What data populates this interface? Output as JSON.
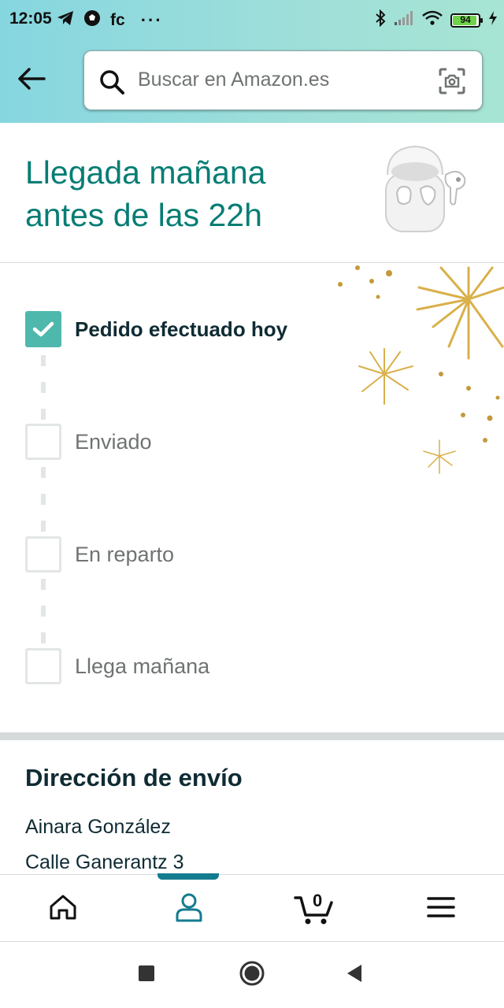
{
  "status_bar": {
    "time": "12:05",
    "carrier_text": "fc",
    "more": "···",
    "battery": "94"
  },
  "search": {
    "placeholder": "Buscar en Amazon.es"
  },
  "arrival": {
    "title_line1": "Llegada mañana",
    "title_line2": "antes de las 22h"
  },
  "progress": {
    "steps": [
      {
        "label": "Pedido efectuado hoy",
        "done": true
      },
      {
        "label": "Enviado",
        "done": false
      },
      {
        "label": "En reparto",
        "done": false
      },
      {
        "label": "Llega mañana",
        "done": false
      }
    ]
  },
  "address": {
    "heading": "Dirección de envío",
    "name": "Ainara González",
    "street": "Calle Ganerantz 3"
  },
  "bottom_nav": {
    "cart_count": "0"
  },
  "colors": {
    "accent_teal": "#067d74",
    "check_teal": "#4fb8ad",
    "nav_active": "#147c8f"
  }
}
